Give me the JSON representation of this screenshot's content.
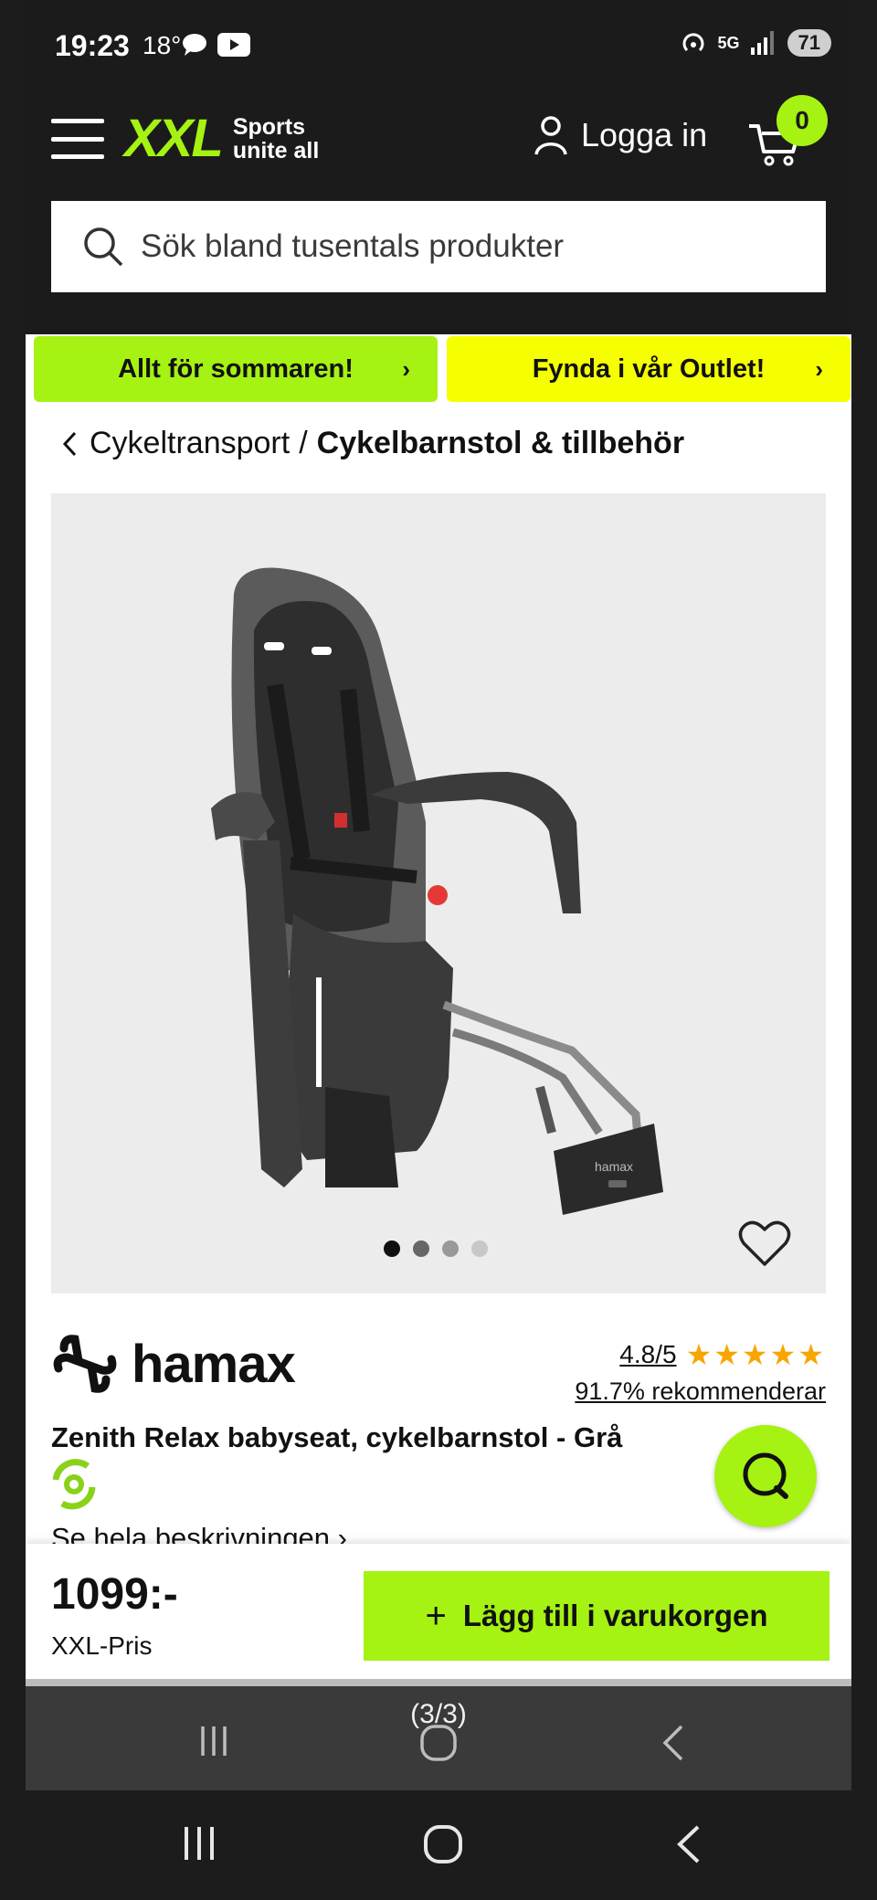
{
  "status_bar": {
    "time": "19:23",
    "temperature": "18°",
    "battery": "71",
    "network": "5G"
  },
  "header": {
    "logo_text": "XXL",
    "logo_tagline_1": "Sports",
    "logo_tagline_2": "unite all",
    "login_label": "Logga in",
    "cart_count": "0",
    "brand_color": "#a5f213"
  },
  "search": {
    "placeholder": "Sök bland tusentals produkter"
  },
  "promos": [
    {
      "label": "Allt för sommaren!",
      "color": "#a5f213"
    },
    {
      "label": "Fynda i vår Outlet!",
      "color": "#f5ff00"
    }
  ],
  "breadcrumb": {
    "parent": "Cykeltransport",
    "separator": "/",
    "current": "Cykelbarnstol & tillbehör"
  },
  "gallery": {
    "image_count": 4,
    "active_index": 0,
    "image_brand_text": "hamax"
  },
  "product": {
    "brand": "hamax",
    "rating": "4.8/5",
    "stars": 5,
    "recommend": "91.7% rekommenderar",
    "title": "Zenith Relax babyseat, cykelbarnstol - Grå",
    "description_link": "Se hela beskrivningen ›"
  },
  "buy": {
    "price": "1099:-",
    "price_label": "XXL-Pris",
    "add_to_cart": "Lägg till i varukorgen"
  },
  "overlay": {
    "page_counter": "(3/3)"
  }
}
